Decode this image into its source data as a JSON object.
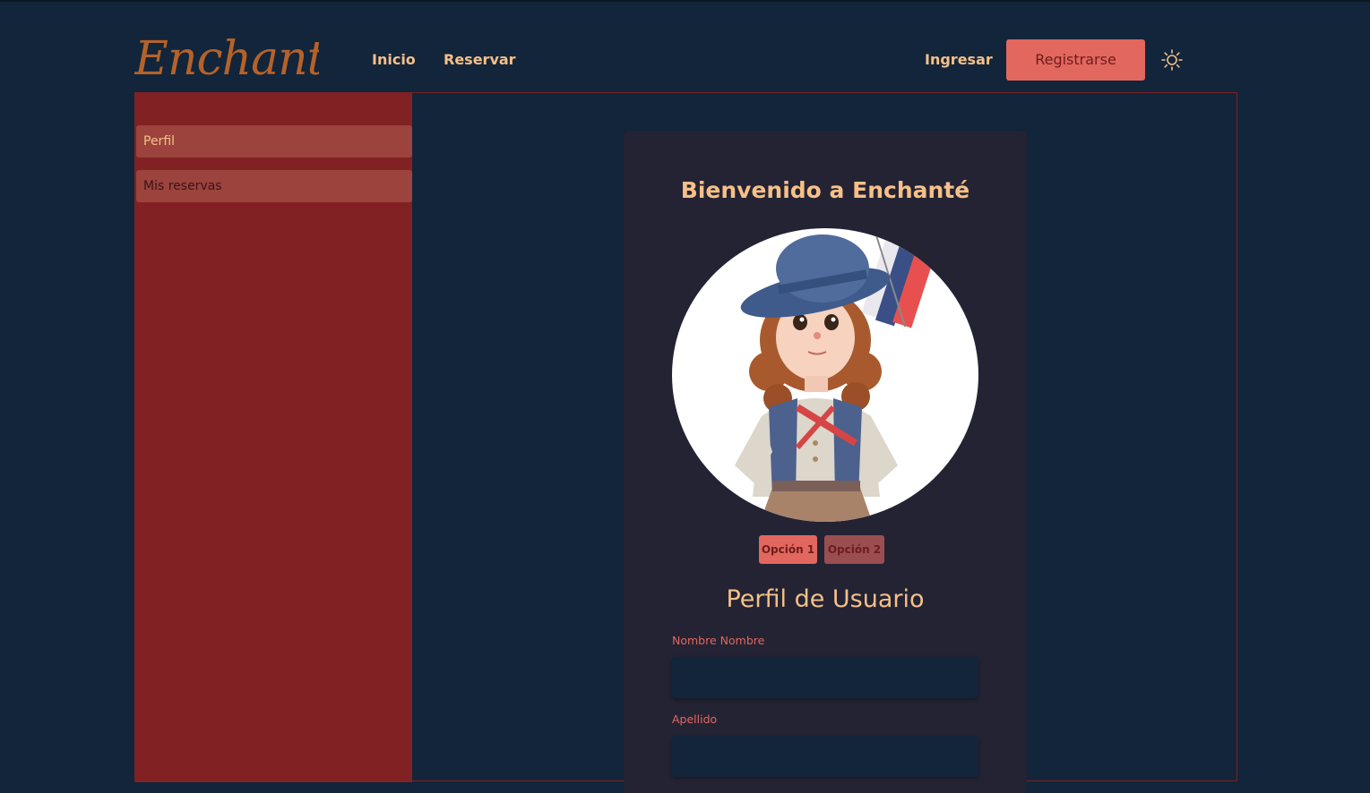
{
  "header": {
    "logo_text": "Enchanté",
    "nav": [
      {
        "label": "Inicio"
      },
      {
        "label": "Reservar"
      }
    ],
    "login_label": "Ingresar",
    "register_label": "Registrarse",
    "theme_icon": "sun-icon"
  },
  "sidebar": {
    "items": [
      {
        "label": "Perfil",
        "active": true
      },
      {
        "label": "Mis reservas",
        "active": false
      }
    ]
  },
  "main": {
    "welcome_title": "Bienvenido a Enchanté",
    "avatar_icon": "avatar-illustration",
    "options": [
      {
        "label": "Opción 1"
      },
      {
        "label": "Opción 2"
      }
    ],
    "profile_title": "Perfil de Usuario",
    "fields": [
      {
        "label": "Nombre Nombre",
        "value": "",
        "placeholder": ""
      },
      {
        "label": "Apellido",
        "value": "",
        "placeholder": ""
      }
    ]
  },
  "colors": {
    "background": "#12253a",
    "sidebar": "#822124",
    "sidebar_item": "#9b433c",
    "accent": "#e2675e",
    "text_gold": "#f6c088",
    "card": "#232334",
    "logo": "#b5622a"
  }
}
